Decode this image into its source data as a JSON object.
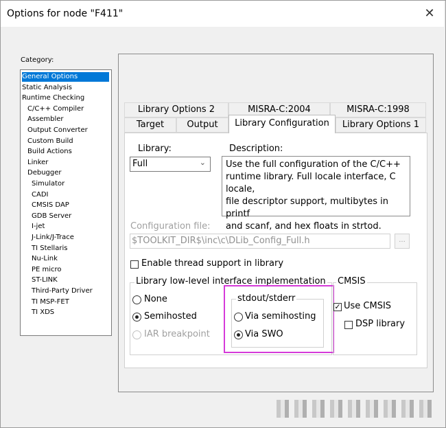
{
  "window": {
    "title": "Options for node \"F411\"",
    "close_glyph": "✕"
  },
  "category": {
    "label": "Category:",
    "items": [
      {
        "label": "General Options",
        "selected": true,
        "indent": 0
      },
      {
        "label": "Static Analysis",
        "indent": 0
      },
      {
        "label": "Runtime Checking",
        "indent": 0
      },
      {
        "label": "C/C++ Compiler",
        "indent": 1
      },
      {
        "label": "Assembler",
        "indent": 1
      },
      {
        "label": "Output Converter",
        "indent": 1
      },
      {
        "label": "Custom Build",
        "indent": 1
      },
      {
        "label": "Build Actions",
        "indent": 1
      },
      {
        "label": "Linker",
        "indent": 1
      },
      {
        "label": "Debugger",
        "indent": 1
      },
      {
        "label": "Simulator",
        "indent": 2
      },
      {
        "label": "CADI",
        "indent": 2
      },
      {
        "label": "CMSIS DAP",
        "indent": 2
      },
      {
        "label": "GDB Server",
        "indent": 2
      },
      {
        "label": "I-jet",
        "indent": 2
      },
      {
        "label": "J-Link/J-Trace",
        "indent": 2
      },
      {
        "label": "TI Stellaris",
        "indent": 2
      },
      {
        "label": "Nu-Link",
        "indent": 2
      },
      {
        "label": "PE micro",
        "indent": 2
      },
      {
        "label": "ST-LINK",
        "indent": 2
      },
      {
        "label": "Third-Party Driver",
        "indent": 2
      },
      {
        "label": "TI MSP-FET",
        "indent": 2
      },
      {
        "label": "TI XDS",
        "indent": 2
      }
    ]
  },
  "tabs": {
    "row1": [
      "Library Options 2",
      "MISRA-C:2004",
      "MISRA-C:1998"
    ],
    "row2": [
      "Target",
      "Output",
      "Library Configuration",
      "Library Options 1"
    ],
    "active": "Library Configuration"
  },
  "library": {
    "label": "Library:",
    "value": "Full",
    "chevron": "⌄"
  },
  "description": {
    "label": "Description:",
    "lines": [
      "Use the full configuration of the C/C++",
      "runtime library. Full locale interface, C locale,",
      "file descriptor support, multibytes in printf",
      "and scanf, and hex floats in strtod."
    ]
  },
  "config_file": {
    "label": "Configuration file:",
    "value": "$TOOLKIT_DIR$\\inc\\c\\DLib_Config_Full.h",
    "browse": "..."
  },
  "thread_support": {
    "label": "Enable thread support in library",
    "checked": false
  },
  "low_level": {
    "legend": "Library low-level interface implementation",
    "options": [
      {
        "label": "None",
        "selected": false,
        "enabled": true
      },
      {
        "label": "Semihosted",
        "selected": true,
        "enabled": true
      },
      {
        "label": "IAR breakpoint",
        "selected": false,
        "enabled": false
      }
    ]
  },
  "stdout": {
    "legend": "stdout/stderr",
    "options": [
      {
        "label": "Via semihosting",
        "selected": false
      },
      {
        "label": "Via SWO",
        "selected": true
      }
    ]
  },
  "cmsis": {
    "legend": "CMSIS",
    "use_cmsis": {
      "label": "Use CMSIS",
      "checked": true
    },
    "dsp_library": {
      "label": "DSP library",
      "checked": false
    }
  },
  "colors": {
    "selection": "#0078d7",
    "highlight_box": "#d53ad9"
  }
}
